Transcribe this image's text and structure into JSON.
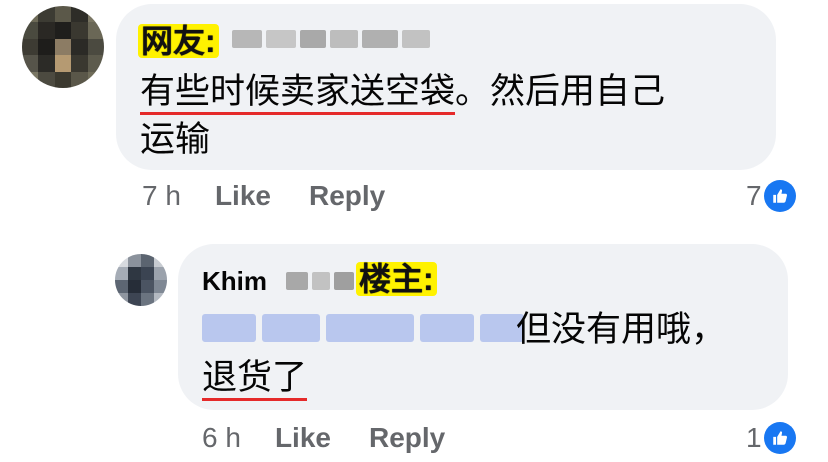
{
  "comments": [
    {
      "tag": "网友:",
      "text_underlined": "有些时候卖家送空袋",
      "text_rest": "。然后用自己",
      "text_line2": "运输",
      "time": "7 h",
      "like_label": "Like",
      "reply_label": "Reply",
      "reaction_count": "7",
      "like_icon": "thumbs-up-icon"
    },
    {
      "author": "Khim",
      "tag": "楼主:",
      "text_rest": "但没有用哦，",
      "text_line2_underlined": "退货了",
      "time": "6 h",
      "like_label": "Like",
      "reply_label": "Reply",
      "reaction_count": "1",
      "like_icon": "thumbs-up-icon"
    }
  ],
  "colors": {
    "bubble": "#f0f2f5",
    "tag_highlight": "#fff200",
    "underline": "#e52a2a",
    "like_blue": "#1877f2",
    "meta_gray": "#65676b"
  }
}
